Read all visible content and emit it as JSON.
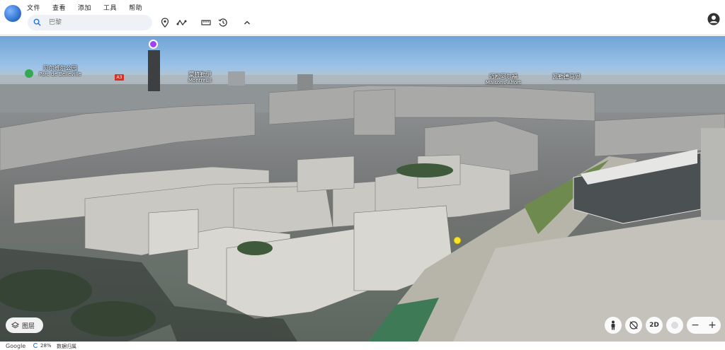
{
  "menu": {
    "items": [
      "文件",
      "查看",
      "添加",
      "工具",
      "帮助"
    ]
  },
  "search": {
    "placeholder": "巴黎"
  },
  "toolbar": {
    "icons": [
      "search-icon",
      "place-pin-icon",
      "path-icon",
      "ruler-icon",
      "history-icon",
      "chevron-up-icon",
      "account-icon"
    ]
  },
  "map": {
    "labels": [
      {
        "name": "贝尔维尔公园",
        "sub": "Parc de Belleville"
      },
      {
        "name": "A3"
      },
      {
        "name": "蒙特勒伊",
        "sub": "Montreuil"
      },
      {
        "name": "迈松阿尔福",
        "sub": "Maisons-Alfort"
      },
      {
        "name": "瓦勒德马恩"
      }
    ]
  },
  "controls": {
    "layers_label": "图层",
    "view_2d_label": "2D",
    "zoom_minus": "−",
    "zoom_plus": "+"
  },
  "status": {
    "brand": "Google",
    "progress_pct": "28%",
    "credit": "数据归属"
  },
  "colors": {
    "accent": "#1a73e8",
    "pin_green": "#34a853",
    "pin_purple": "#a142f4",
    "road_sign_red": "#d93025"
  }
}
